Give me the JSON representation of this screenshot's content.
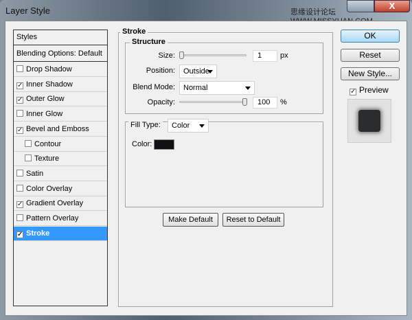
{
  "window": {
    "title": "Layer Style",
    "watermark": "思缘设计论坛 WWW.MISSYUAN.COM",
    "close_glyph": "X"
  },
  "styles_list": {
    "header": "Styles",
    "blending": "Blending Options: Default",
    "items": [
      {
        "label": "Drop Shadow",
        "checked": false,
        "indent": false
      },
      {
        "label": "Inner Shadow",
        "checked": true,
        "indent": false
      },
      {
        "label": "Outer Glow",
        "checked": true,
        "indent": false
      },
      {
        "label": "Inner Glow",
        "checked": false,
        "indent": false
      },
      {
        "label": "Bevel and Emboss",
        "checked": true,
        "indent": false
      },
      {
        "label": "Contour",
        "checked": false,
        "indent": true
      },
      {
        "label": "Texture",
        "checked": false,
        "indent": true
      },
      {
        "label": "Satin",
        "checked": false,
        "indent": false
      },
      {
        "label": "Color Overlay",
        "checked": false,
        "indent": false
      },
      {
        "label": "Gradient Overlay",
        "checked": true,
        "indent": false
      },
      {
        "label": "Pattern Overlay",
        "checked": false,
        "indent": false
      },
      {
        "label": "Stroke",
        "checked": true,
        "indent": false,
        "selected": true
      }
    ]
  },
  "stroke": {
    "title": "Stroke",
    "structure": "Structure",
    "size_label": "Size:",
    "size_value": "1",
    "size_unit": "px",
    "size_slider": 0.0,
    "position_label": "Position:",
    "position_value": "Outside",
    "blend_label": "Blend Mode:",
    "blend_value": "Normal",
    "opacity_label": "Opacity:",
    "opacity_value": "100",
    "opacity_unit": "%",
    "opacity_slider": 1.0,
    "fill_type_label": "Fill Type:",
    "fill_type_value": "Color",
    "color_label": "Color:",
    "color_value": "#111114",
    "make_default": "Make Default",
    "reset_default": "Reset to Default"
  },
  "buttons": {
    "ok": "OK",
    "reset": "Reset",
    "new_style": "New Style...",
    "preview": "Preview",
    "preview_checked": true
  }
}
